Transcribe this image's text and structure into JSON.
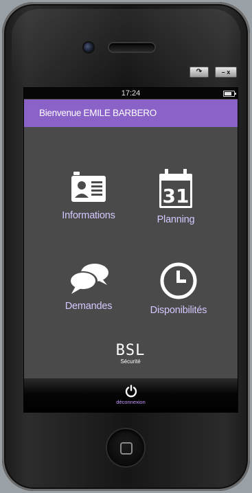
{
  "window_controls": {
    "rotate": "↷",
    "minmax": "– x"
  },
  "status_bar": {
    "time": "17:24"
  },
  "header": {
    "title": "Bienvenue EMILE BARBERO",
    "color": "#8b62c7"
  },
  "menu": [
    {
      "label": "Informations",
      "icon": "id-card-icon"
    },
    {
      "label": "Planning",
      "icon": "calendar-icon",
      "icon_text": "31"
    },
    {
      "label": "Demandes",
      "icon": "chat-bubbles-icon"
    },
    {
      "label": "Disponibilités",
      "icon": "clock-icon"
    }
  ],
  "logo": {
    "main": "BSL",
    "sub": "Sécurité"
  },
  "bottom_bar": {
    "logout_label": "déconnexion",
    "icon": "power-icon"
  },
  "colors": {
    "accent": "#8b62c7",
    "menu_label": "#d6c8ff",
    "screen_bg": "#4a4a4a"
  }
}
